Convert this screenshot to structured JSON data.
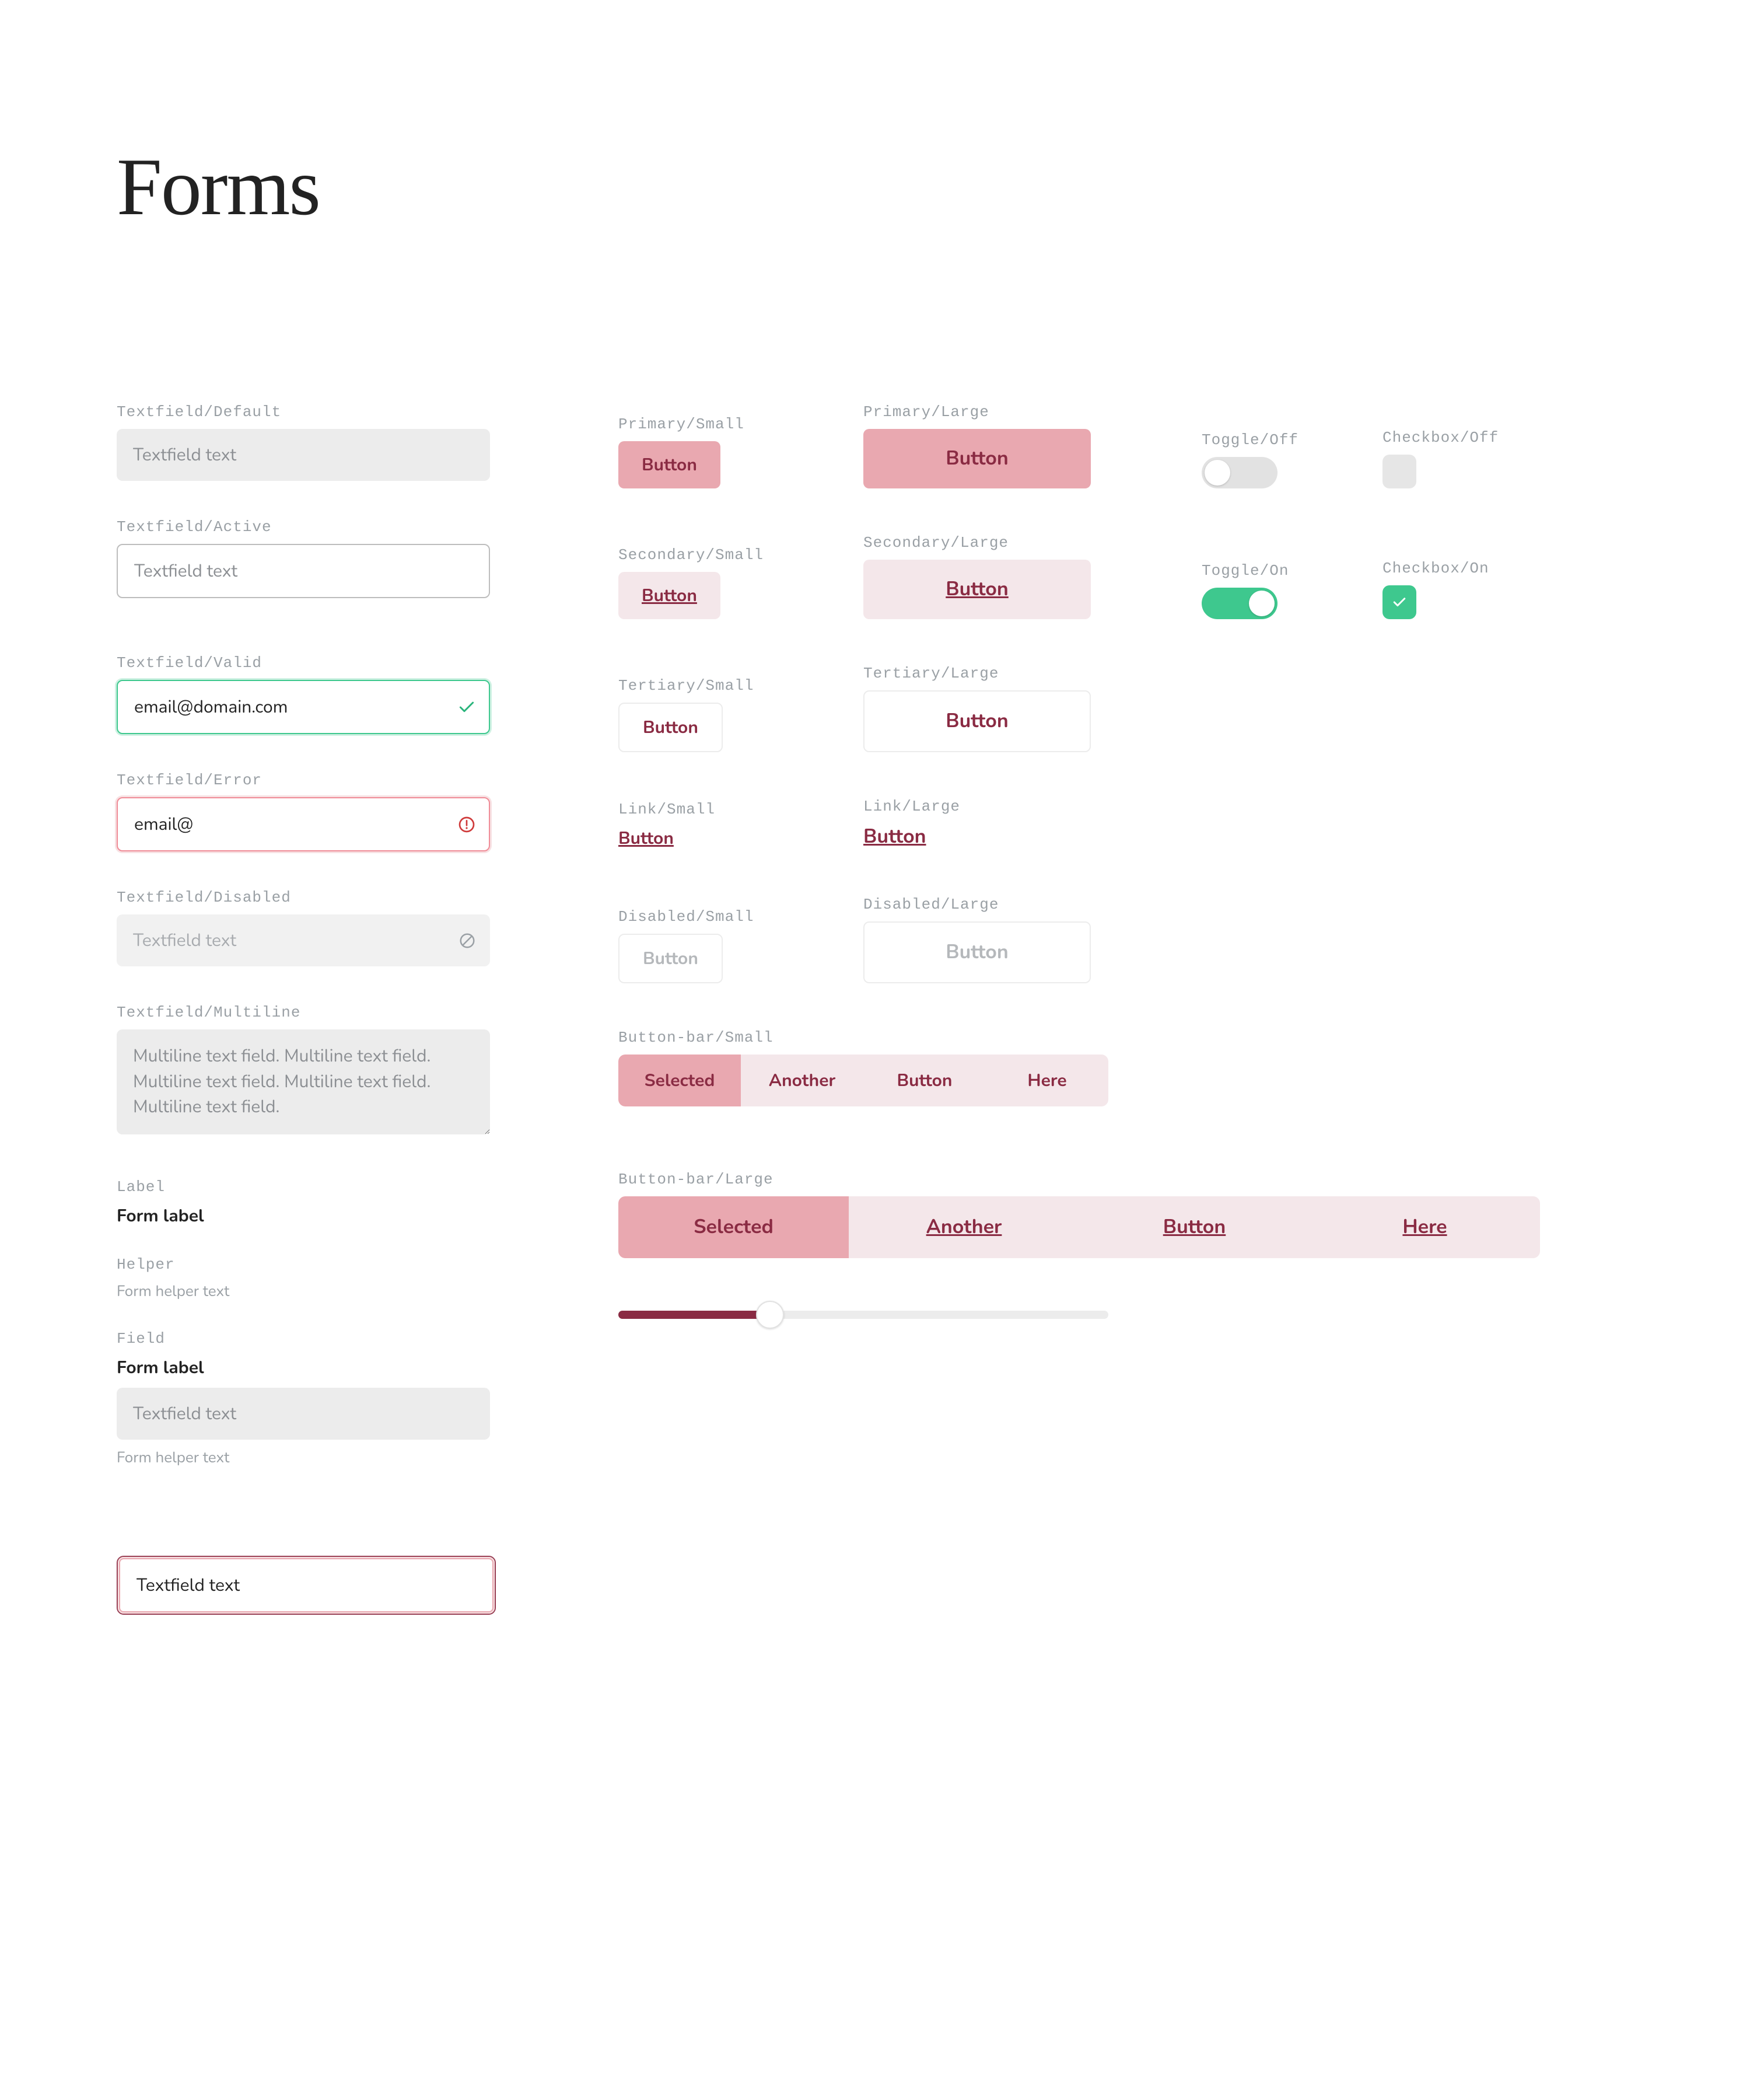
{
  "page": {
    "title": "Forms"
  },
  "textfields": {
    "default": {
      "caption": "Textfield/Default",
      "value": "Textfield text"
    },
    "active": {
      "caption": "Textfield/Active",
      "value": "Textfield text"
    },
    "valid": {
      "caption": "Textfield/Valid",
      "value": "email@domain.com"
    },
    "error": {
      "caption": "Textfield/Error",
      "value": "email@"
    },
    "disabled": {
      "caption": "Textfield/Disabled",
      "value": "Textfield text"
    },
    "multiline": {
      "caption": "Textfield/Multiline",
      "value": "Multiline text field. Multiline text field. Multiline text field. Multiline text field. Multiline text field."
    },
    "ringed": {
      "value": "Textfield text"
    }
  },
  "label": {
    "caption": "Label",
    "text": "Form label"
  },
  "helper": {
    "caption": "Helper",
    "text": "Form helper text"
  },
  "field_combo": {
    "caption": "Field",
    "label": "Form label",
    "value": "Textfield text",
    "helper": "Form helper text"
  },
  "buttons": {
    "primary_small": {
      "caption": "Primary/Small",
      "label": "Button"
    },
    "primary_large": {
      "caption": "Primary/Large",
      "label": "Button"
    },
    "secondary_small": {
      "caption": "Secondary/Small",
      "label": "Button"
    },
    "secondary_large": {
      "caption": "Secondary/Large",
      "label": "Button"
    },
    "tertiary_small": {
      "caption": "Tertiary/Small",
      "label": "Button"
    },
    "tertiary_large": {
      "caption": "Tertiary/Large",
      "label": "Button"
    },
    "link_small": {
      "caption": "Link/Small",
      "label": "Button"
    },
    "link_large": {
      "caption": "Link/Large",
      "label": "Button"
    },
    "disabled_small": {
      "caption": "Disabled/Small",
      "label": "Button"
    },
    "disabled_large": {
      "caption": "Disabled/Large",
      "label": "Button"
    }
  },
  "toggles": {
    "off": {
      "caption": "Toggle/Off"
    },
    "on": {
      "caption": "Toggle/On"
    }
  },
  "checkboxes": {
    "off": {
      "caption": "Checkbox/Off"
    },
    "on": {
      "caption": "Checkbox/On"
    }
  },
  "button_bar_small": {
    "caption": "Button-bar/Small",
    "items": [
      "Selected",
      "Another",
      "Button",
      "Here"
    ],
    "selected_index": 0
  },
  "button_bar_large": {
    "caption": "Button-bar/Large",
    "items": [
      "Selected",
      "Another",
      "Button",
      "Here"
    ],
    "selected_index": 0
  },
  "slider": {
    "value_percent": 31
  },
  "colors": {
    "accent": "#8a2b43",
    "accent_tint": "#e9a8b0",
    "accent_bg": "#f4e7ea",
    "success": "#3ec88e"
  }
}
